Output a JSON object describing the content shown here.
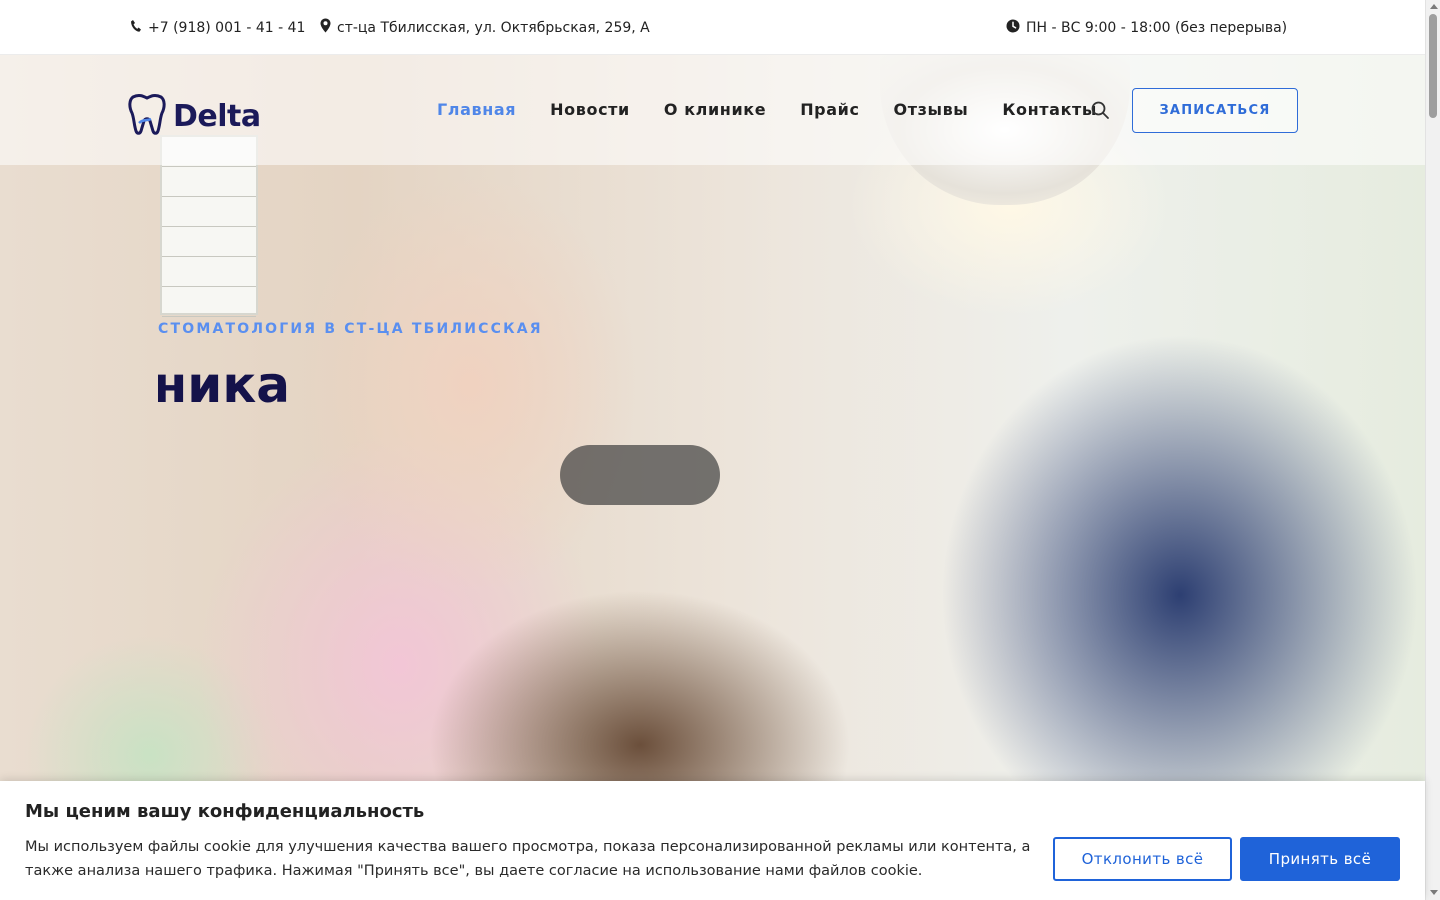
{
  "topbar": {
    "phone": "+7 (918) 001 - 41 - 41",
    "phone_icon": "phone-icon",
    "address": "ст-ца Тбилисская, ул. Октябрьская, 259, А",
    "address_icon": "map-pin-icon",
    "hours": "ПН - ВС 9:00 - 18:00 (без перерыва)",
    "hours_icon": "clock-icon"
  },
  "header": {
    "logo_text": "Delta",
    "logo_icon": "tooth-icon",
    "nav": [
      {
        "label": "Главная",
        "active": true
      },
      {
        "label": "Новости",
        "active": false
      },
      {
        "label": "О клинике",
        "active": false
      },
      {
        "label": "Прайс",
        "active": false
      },
      {
        "label": "Отзывы",
        "active": false
      },
      {
        "label": "Контакты",
        "active": false
      }
    ],
    "search_icon": "search-icon",
    "cta_label": "ЗАПИСАТЬСЯ"
  },
  "hero": {
    "subtitle": "СТОМАТОЛОГИЯ В СТ-ЦА ТБИЛИССКАЯ",
    "title_visible": "ника"
  },
  "cookie": {
    "title": "Мы ценим вашу конфиденциальность",
    "text": "Мы используем файлы cookie для улучшения качества вашего просмотра, показа персонализированной рекламы или контента, а также анализа нашего трафика. Нажимая \"Принять все\", вы даете согласие на использование нами файлов cookie.",
    "decline_label": "Отклонить всё",
    "accept_label": "Принять всё"
  },
  "colors": {
    "accent": "#1f63d9",
    "nav_active": "#4f86e8",
    "brand_dark": "#1b1a5a"
  }
}
